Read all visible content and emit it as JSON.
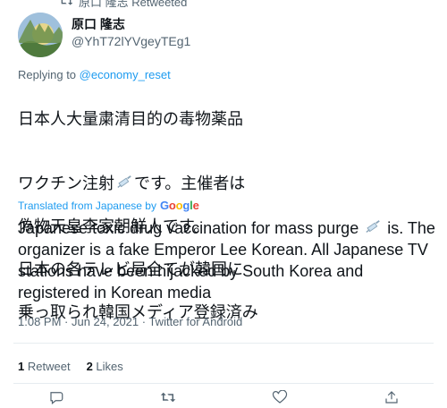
{
  "retweet": {
    "label": "原口 隆志 Retweeted"
  },
  "author": {
    "display_name": "原口 隆志",
    "handle": "@YhT72lYVgeyTEg1"
  },
  "reply": {
    "prefix": "Replying to ",
    "target": "@economy_reset"
  },
  "tweet": {
    "jp_line1": "日本人大量粛清目的の毒物薬品",
    "jp_line2a": "ワクチン注射",
    "jp_line2b": "です。主催者は",
    "jp_line3": "偽物天皇李家朝鮮人です。",
    "jp_line4": "日本の各テレビ局全てが韓国に",
    "jp_line5": "乗っ取られ韓国メディア登録済み",
    "translated_label": "Translated from Japanese by",
    "google_g": "G",
    "google_o1": "o",
    "google_o2": "o",
    "google_g2": "g",
    "google_l": "l",
    "google_e": "e",
    "en_part1": "Japanese toxic drug vaccination for mass purge ",
    "en_part2": " is. The organizer is a fake Emperor Lee Korean.  All Japanese TV stations have been hijacked by South Korea and registered in Korean media"
  },
  "meta": {
    "time": "1:08 PM · Jun 24, 2021 · Twitter for Android"
  },
  "stats": {
    "retweets_count": "1",
    "retweets_label": "Retweet",
    "likes_count": "2",
    "likes_label": "Likes"
  },
  "icons": [
    "retweet-icon",
    "syringe-icon",
    "reply-icon",
    "like-icon",
    "share-icon"
  ]
}
